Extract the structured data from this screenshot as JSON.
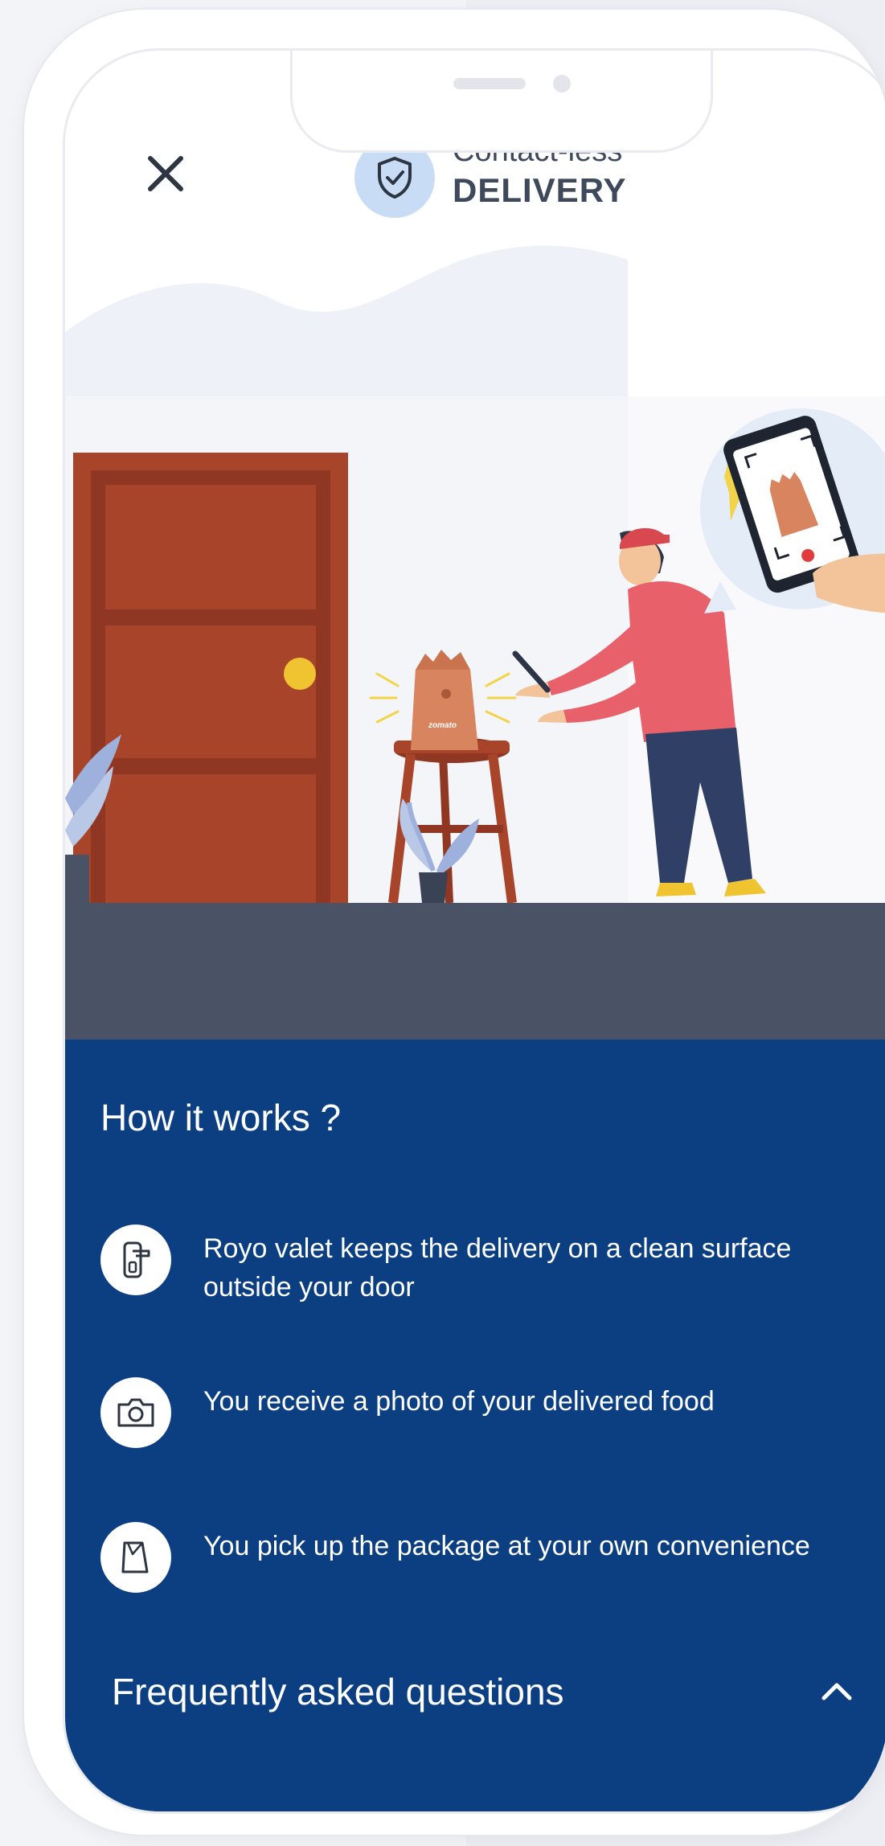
{
  "header": {
    "close_icon": "close-icon",
    "logo_icon": "shield-check-icon",
    "brand_top": "Contact-less",
    "brand_bottom": "DELIVERY"
  },
  "illustration": {
    "bag_label": "zomato"
  },
  "how_it_works": {
    "title": "How it works ?",
    "steps": [
      {
        "icon": "door-handle-icon",
        "text": "Royo valet keeps the delivery on a clean surface outside your door"
      },
      {
        "icon": "camera-icon",
        "text": "You receive a photo of your delivered food"
      },
      {
        "icon": "package-icon",
        "text": "You pick up the package at your own convenience"
      }
    ]
  },
  "faq": {
    "label": "Frequently asked questions",
    "toggle_icon": "chevron-up-icon"
  },
  "colors": {
    "panel_blue": "#0b3f82",
    "door": "#a8442a",
    "shirt": "#e8606a",
    "floor": "#4a5366",
    "badge": "#c8ddf5"
  }
}
